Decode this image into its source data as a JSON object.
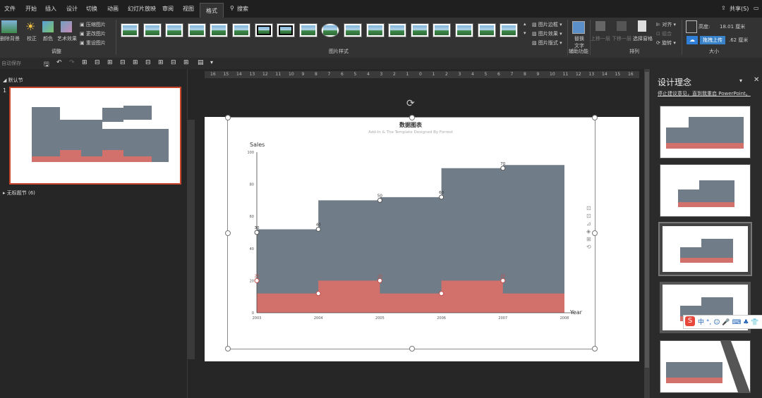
{
  "tabs": [
    "文件",
    "开始",
    "插入",
    "设计",
    "切换",
    "动画",
    "幻灯片放映",
    "审阅",
    "视图",
    "格式"
  ],
  "active_tab": "格式",
  "search_placeholder": "搜索",
  "share_label": "共享(S)",
  "ribbon": {
    "adjust": {
      "remove_bg": "删除背景",
      "correct": "校正",
      "color": "颜色",
      "artistic": "艺术效果",
      "compress": "压缩图片",
      "change": "更改图片",
      "reset": "重设图片",
      "group": "调整"
    },
    "styles": {
      "group": "图片样式",
      "border": "图片边框",
      "effects": "图片效果",
      "layout": "图片版式"
    },
    "accessibility": {
      "alt_text": "替换文字",
      "group": "辅助功能"
    },
    "arrange": {
      "bring_forward": "上移一层",
      "send_backward": "下移一层",
      "selection_pane": "选择窗格",
      "align": "对齐",
      "group_btn": "组合",
      "rotate": "旋转",
      "group": "排列"
    },
    "size": {
      "crop": "裁剪",
      "height_label": "高度:",
      "height_value": "18.01 厘米",
      "width_value": ".62 厘米",
      "upload": "拖拽上传",
      "group": "大小"
    }
  },
  "qat": {
    "autosave": "自动保存"
  },
  "sections": {
    "default": "默认节",
    "untitled": "无标题节 (6)"
  },
  "slide_number": "1",
  "right_panel": {
    "title": "设计理念",
    "link": "停止建议意见，直到我重启 PowerPoint。"
  },
  "chart_data": {
    "type": "area",
    "title": "数据图表",
    "subtitle": "Add-In & The Template Designed By Forrest",
    "xlabel": "Year",
    "ylabel": "Sales",
    "x": [
      2003,
      2004,
      2005,
      2006,
      2007,
      2008
    ],
    "ylim": [
      0,
      100
    ],
    "yticks": [
      0,
      20,
      40,
      60,
      80,
      100
    ],
    "series": [
      {
        "values": [
          52,
          70,
          72,
          90,
          92,
          92
        ],
        "color": "#707c87",
        "point_labels": [
          "30",
          "40",
          "50",
          "60",
          "70",
          ""
        ]
      },
      {
        "values": [
          12,
          20,
          12,
          20,
          12,
          12
        ],
        "color": "#d2706c",
        "point_labels": [
          "20",
          "",
          "20",
          "",
          "20",
          ""
        ]
      }
    ],
    "markers": {
      "grey": [
        [
          2003,
          50
        ],
        [
          2004,
          52
        ],
        [
          2005,
          70
        ],
        [
          2006,
          72
        ],
        [
          2007,
          90
        ]
      ],
      "red": [
        [
          2003,
          20
        ],
        [
          2004,
          12
        ],
        [
          2005,
          20
        ],
        [
          2006,
          12
        ],
        [
          2007,
          20
        ]
      ]
    }
  },
  "ruler_labels": [
    "16",
    "15",
    "14",
    "13",
    "12",
    "11",
    "10",
    "9",
    "8",
    "7",
    "6",
    "5",
    "4",
    "3",
    "2",
    "1",
    "0",
    "1",
    "2",
    "3",
    "4",
    "5",
    "6",
    "7",
    "8",
    "9",
    "10",
    "11",
    "12",
    "13",
    "14",
    "15",
    "16"
  ],
  "colors": {
    "accent": "#c9462c",
    "grey_area": "#707c87",
    "red_area": "#d2706c"
  }
}
